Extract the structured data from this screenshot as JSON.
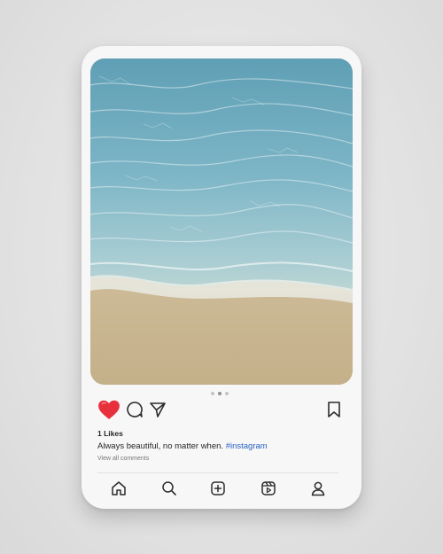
{
  "post": {
    "likes": "1 Likes",
    "caption_text": "Always beautiful, no matter when.",
    "caption_hashtag": "#instagram",
    "view_all_comments": "View all comments",
    "carousel": {
      "count": 3,
      "active_index": 1
    },
    "liked": true
  },
  "actions": [
    "heart-icon",
    "comment-icon",
    "send-icon",
    "bookmark-icon"
  ],
  "nav": [
    "home-icon",
    "search-icon",
    "add-post-icon",
    "reels-icon",
    "profile-icon"
  ],
  "colors": {
    "like": "#e8303c",
    "hashtag": "#2a5fc2",
    "icon": "#2b2b2b"
  }
}
